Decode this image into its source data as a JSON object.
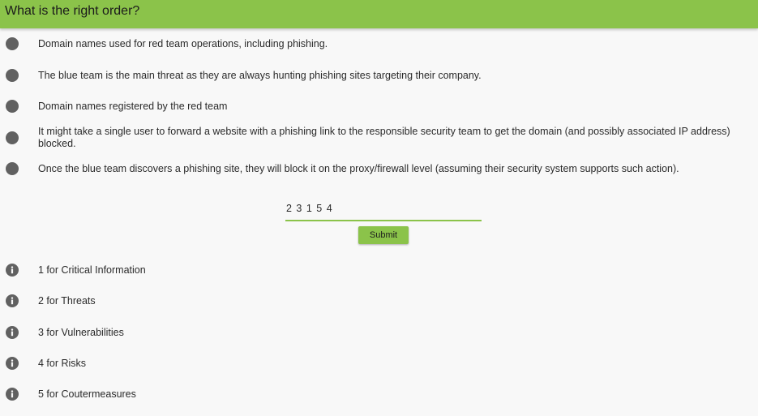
{
  "header": {
    "title": "What is the right order?"
  },
  "options": [
    {
      "text": "Domain names used for red team operations, including phishing."
    },
    {
      "text": "The blue team is the main threat as they are always hunting phishing sites targeting their company."
    },
    {
      "text": "Domain names registered by the red team"
    },
    {
      "text": "It might take a single user to forward a website with a phishing link to the responsible security team to get the domain (and possibly associated IP address) blocked."
    },
    {
      "text": "Once the blue team discovers a phishing site, they will block it on the proxy/firewall level (assuming their security system supports such action)."
    }
  ],
  "answer": {
    "value": "2 3 1 5 4"
  },
  "submit": {
    "label": "Submit"
  },
  "hints": [
    {
      "text": "1 for Critical Information"
    },
    {
      "text": "2 for Threats"
    },
    {
      "text": "3 for Vulnerabilities"
    },
    {
      "text": "4 for Risks"
    },
    {
      "text": "5 for Coutermeasures"
    }
  ],
  "colors": {
    "accent": "#8bc34a",
    "bullet": "#616161",
    "background": "#f8f8f8"
  },
  "icons": {
    "bullet": "filled-circle",
    "hint": "info-icon"
  }
}
